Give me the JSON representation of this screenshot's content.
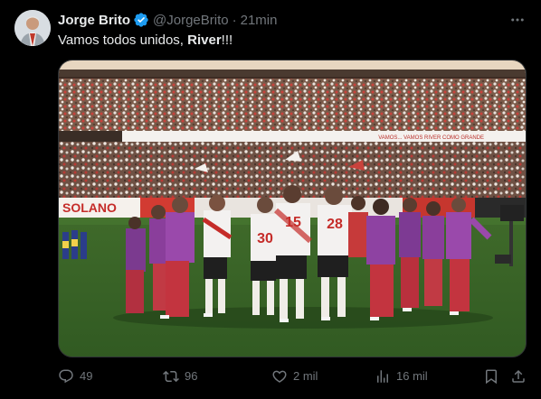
{
  "tweet": {
    "author_name": "Jorge Brito",
    "handle": "@JorgeBrito",
    "separator": "·",
    "time": "21min",
    "text_prefix": "Vamos todos unidos, ",
    "text_bold": "River",
    "text_suffix": "!!!",
    "image_banners": {
      "left_ad": "SOLANO",
      "stand_banner": "VAMOS... VAMOS RIVER COMO GRANDE"
    },
    "players_numbers": [
      "15",
      "28",
      "30"
    ]
  },
  "actions": {
    "replies": "49",
    "retweets": "96",
    "likes": "2 mil",
    "views": "16 mil"
  },
  "icons": {
    "more": "more-horizontal-icon",
    "reply": "reply-icon",
    "retweet": "retweet-icon",
    "like": "heart-icon",
    "views": "views-chart-icon",
    "bookmark": "bookmark-icon",
    "share": "share-icon",
    "verified": "verified-badge-icon"
  },
  "colors": {
    "background": "#000000",
    "text": "#e7e9ea",
    "muted": "#71767b",
    "verified": "#1d9bf0"
  }
}
